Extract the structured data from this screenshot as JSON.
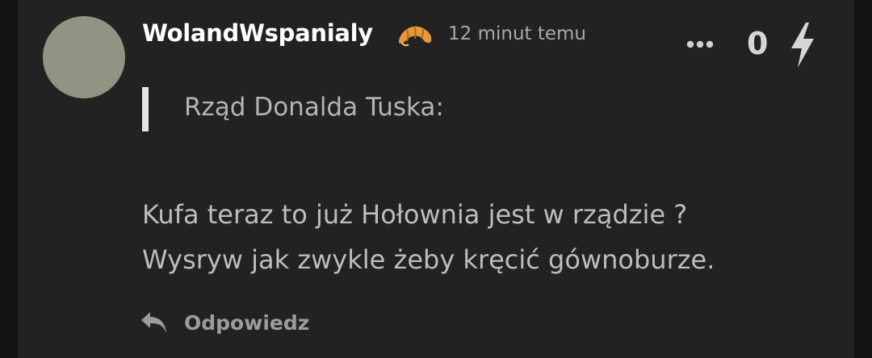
{
  "comment": {
    "username": "WolandWspanialy",
    "timestamp": "12 minut temu",
    "score": "0",
    "quote": "Rząd Donalda Tuska:",
    "body_lines": [
      "Kufa teraz to już Hołownia jest w rządzie ?",
      "Wysryw jak zwykle żeby kręcić gównoburze."
    ],
    "reply_label": "Odpowiedz",
    "badge_icon": "croissant-icon",
    "avatar_color": "#8f9582"
  },
  "colors": {
    "background": "#141414",
    "card": "#222222",
    "username": "#ffffff",
    "muted": "#a8a8a8",
    "body": "#bdbdbd"
  }
}
